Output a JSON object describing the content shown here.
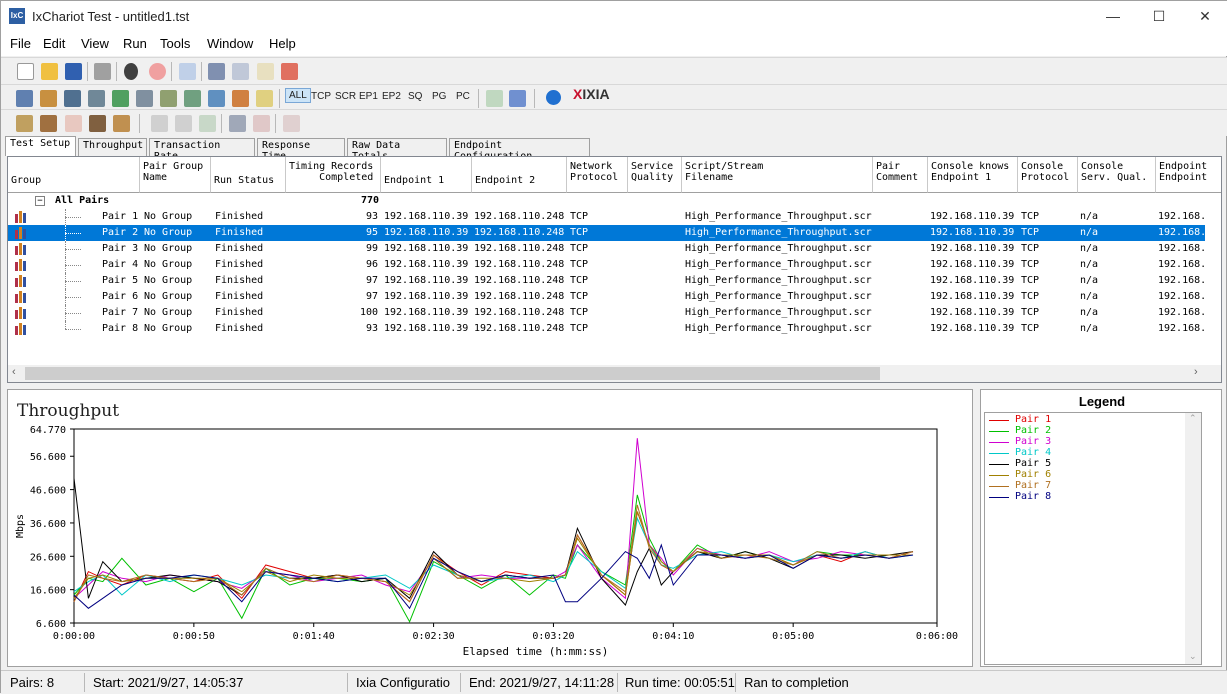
{
  "window": {
    "title": "IxChariot Test - untitled1.tst",
    "icon_text": "IxC"
  },
  "menu": [
    "File",
    "Edit",
    "View",
    "Run",
    "Tools",
    "Window",
    "Help"
  ],
  "menu_underline": [
    "F",
    "E",
    "V",
    "R",
    "T",
    "W",
    "H"
  ],
  "toolbar2_filters": [
    "ALL",
    "TCP",
    "SCR",
    "EP1",
    "EP2",
    "SQ",
    "PG",
    "PC"
  ],
  "logo": {
    "x": "X",
    "rest": "IXIA"
  },
  "tabs": [
    "Test Setup",
    "Throughput",
    "Transaction Rate",
    "Response Time",
    "Raw Data Totals",
    "Endpoint Configuration"
  ],
  "columns": {
    "group": "Group",
    "pair_group": "Pair Group\nName",
    "run_status": "Run Status",
    "timing": "Timing Records\n     Completed",
    "ep1": "Endpoint 1",
    "ep2": "Endpoint 2",
    "proto": "Network\nProtocol",
    "sq": "Service\nQuality",
    "script": "Script/Stream\nFilename",
    "comment": "Pair\nComment",
    "console_knows": "Console knows\nEndpoint 1",
    "console_proto": "Console\nProtocol",
    "console_sq": "Console\nServ. Qual.",
    "endpoint_last": "Endpoint\nEndpoint"
  },
  "all_pairs": {
    "label": "All Pairs",
    "total": "770",
    "expander": "−"
  },
  "rows": [
    {
      "pair": "Pair 1",
      "group": "No Group",
      "status": "Finished",
      "records": "93",
      "ep1": "192.168.110.39",
      "ep2": "192.168.110.248",
      "proto": "TCP",
      "script": "High_Performance_Throughput.scr",
      "console": "192.168.110.39",
      "cproto": "TCP",
      "csq": "n/a",
      "last": "192.168."
    },
    {
      "pair": "Pair 2",
      "group": "No Group",
      "status": "Finished",
      "records": "95",
      "ep1": "192.168.110.39",
      "ep2": "192.168.110.248",
      "proto": "TCP",
      "script": "High_Performance_Throughput.scr",
      "console": "192.168.110.39",
      "cproto": "TCP",
      "csq": "n/a",
      "last": "192.168."
    },
    {
      "pair": "Pair 3",
      "group": "No Group",
      "status": "Finished",
      "records": "99",
      "ep1": "192.168.110.39",
      "ep2": "192.168.110.248",
      "proto": "TCP",
      "script": "High_Performance_Throughput.scr",
      "console": "192.168.110.39",
      "cproto": "TCP",
      "csq": "n/a",
      "last": "192.168."
    },
    {
      "pair": "Pair 4",
      "group": "No Group",
      "status": "Finished",
      "records": "96",
      "ep1": "192.168.110.39",
      "ep2": "192.168.110.248",
      "proto": "TCP",
      "script": "High_Performance_Throughput.scr",
      "console": "192.168.110.39",
      "cproto": "TCP",
      "csq": "n/a",
      "last": "192.168."
    },
    {
      "pair": "Pair 5",
      "group": "No Group",
      "status": "Finished",
      "records": "97",
      "ep1": "192.168.110.39",
      "ep2": "192.168.110.248",
      "proto": "TCP",
      "script": "High_Performance_Throughput.scr",
      "console": "192.168.110.39",
      "cproto": "TCP",
      "csq": "n/a",
      "last": "192.168."
    },
    {
      "pair": "Pair 6",
      "group": "No Group",
      "status": "Finished",
      "records": "97",
      "ep1": "192.168.110.39",
      "ep2": "192.168.110.248",
      "proto": "TCP",
      "script": "High_Performance_Throughput.scr",
      "console": "192.168.110.39",
      "cproto": "TCP",
      "csq": "n/a",
      "last": "192.168."
    },
    {
      "pair": "Pair 7",
      "group": "No Group",
      "status": "Finished",
      "records": "100",
      "ep1": "192.168.110.39",
      "ep2": "192.168.110.248",
      "proto": "TCP",
      "script": "High_Performance_Throughput.scr",
      "console": "192.168.110.39",
      "cproto": "TCP",
      "csq": "n/a",
      "last": "192.168."
    },
    {
      "pair": "Pair 8",
      "group": "No Group",
      "status": "Finished",
      "records": "93",
      "ep1": "192.168.110.39",
      "ep2": "192.168.110.248",
      "proto": "TCP",
      "script": "High_Performance_Throughput.scr",
      "console": "192.168.110.39",
      "cproto": "TCP",
      "csq": "n/a",
      "last": "192.168."
    }
  ],
  "selected_row": 1,
  "legend": {
    "title": "Legend",
    "items": [
      {
        "name": "Pair 1",
        "color": "#e00000"
      },
      {
        "name": "Pair 2",
        "color": "#00c000"
      },
      {
        "name": "Pair 3",
        "color": "#d000d0"
      },
      {
        "name": "Pair 4",
        "color": "#00c8c8"
      },
      {
        "name": "Pair 5",
        "color": "#000000"
      },
      {
        "name": "Pair 6",
        "color": "#a08000"
      },
      {
        "name": "Pair 7",
        "color": "#b07020"
      },
      {
        "name": "Pair 8",
        "color": "#000080"
      }
    ]
  },
  "chart_data": {
    "type": "line",
    "title": "Throughput",
    "xlabel": "Elapsed time (h:mm:ss)",
    "ylabel": "Mbps",
    "x_ticks": [
      "0:00:00",
      "0:00:50",
      "0:01:40",
      "0:02:30",
      "0:03:20",
      "0:04:10",
      "0:05:00",
      "0:06:00"
    ],
    "x_tick_seconds": [
      0,
      50,
      100,
      150,
      200,
      250,
      300,
      360
    ],
    "y_ticks": [
      "64.770",
      "56.600",
      "46.600",
      "36.600",
      "26.600",
      "16.600",
      "6.600"
    ],
    "y_tick_values": [
      64.77,
      56.6,
      46.6,
      36.6,
      26.6,
      16.6,
      6.6
    ],
    "xlim": [
      0,
      360
    ],
    "ylim": [
      6.6,
      64.77
    ],
    "grid": false,
    "series": [
      {
        "name": "Pair 1",
        "x": [
          0,
          6,
          12,
          20,
          30,
          40,
          50,
          60,
          70,
          80,
          90,
          100,
          110,
          120,
          130,
          140,
          150,
          160,
          170,
          180,
          190,
          200,
          205,
          210,
          220,
          230,
          235,
          240,
          245,
          250,
          260,
          270,
          280,
          290,
          300,
          310,
          320,
          330,
          340,
          350
        ],
        "y": [
          13,
          22,
          20,
          18,
          21,
          20,
          19,
          21,
          14,
          24,
          22,
          20,
          21,
          20,
          19,
          13,
          27,
          22,
          18,
          22,
          21,
          20,
          21,
          33,
          21,
          15,
          40,
          30,
          24,
          22,
          28,
          27,
          26,
          27,
          24,
          27,
          25,
          28,
          26,
          28
        ]
      },
      {
        "name": "Pair 2",
        "x": [
          0,
          6,
          12,
          20,
          30,
          40,
          50,
          60,
          70,
          80,
          90,
          100,
          110,
          120,
          130,
          140,
          150,
          160,
          170,
          180,
          190,
          200,
          205,
          210,
          220,
          230,
          235,
          240,
          245,
          250,
          260,
          270,
          280,
          290,
          300,
          310,
          320,
          330,
          340,
          350
        ],
        "y": [
          15,
          20,
          19,
          26,
          18,
          20,
          16,
          20,
          8,
          23,
          18,
          20,
          20,
          19,
          20,
          7,
          25,
          21,
          17,
          21,
          15,
          21,
          20,
          30,
          22,
          18,
          45,
          32,
          25,
          22,
          30,
          26,
          28,
          26,
          24,
          28,
          27,
          27,
          27,
          27
        ]
      },
      {
        "name": "Pair 3",
        "x": [
          0,
          6,
          12,
          20,
          30,
          40,
          50,
          60,
          70,
          80,
          90,
          100,
          110,
          120,
          130,
          140,
          150,
          160,
          170,
          180,
          190,
          200,
          205,
          210,
          220,
          230,
          235,
          240,
          245,
          250,
          260,
          270,
          280,
          290,
          300,
          310,
          320,
          330,
          340,
          350
        ],
        "y": [
          14,
          18,
          22,
          20,
          19,
          21,
          20,
          19,
          17,
          22,
          21,
          19,
          20,
          21,
          18,
          16,
          26,
          20,
          21,
          20,
          20,
          20,
          22,
          30,
          20,
          14,
          62,
          30,
          26,
          21,
          29,
          27,
          26,
          28,
          25,
          26,
          28,
          27,
          27,
          27
        ]
      },
      {
        "name": "Pair 4",
        "x": [
          0,
          6,
          12,
          20,
          30,
          40,
          50,
          60,
          70,
          80,
          90,
          100,
          110,
          120,
          130,
          140,
          150,
          160,
          170,
          180,
          190,
          200,
          205,
          210,
          220,
          230,
          235,
          240,
          245,
          250,
          260,
          270,
          280,
          290,
          300,
          310,
          320,
          330,
          340,
          350
        ],
        "y": [
          16,
          19,
          21,
          15,
          21,
          19,
          21,
          20,
          18,
          21,
          20,
          20,
          19,
          20,
          21,
          17,
          24,
          21,
          19,
          20,
          21,
          19,
          21,
          28,
          22,
          17,
          38,
          30,
          24,
          23,
          27,
          28,
          26,
          27,
          25,
          27,
          26,
          28,
          26,
          27
        ]
      },
      {
        "name": "Pair 5",
        "x": [
          0,
          6,
          12,
          20,
          30,
          40,
          50,
          60,
          70,
          80,
          90,
          100,
          110,
          120,
          130,
          140,
          150,
          160,
          170,
          180,
          190,
          200,
          205,
          210,
          220,
          230,
          235,
          240,
          245,
          250,
          260,
          270,
          280,
          290,
          300,
          310,
          320,
          330,
          340,
          350
        ],
        "y": [
          50,
          14,
          25,
          19,
          20,
          21,
          20,
          19,
          15,
          23,
          20,
          20,
          21,
          19,
          20,
          14,
          28,
          21,
          19,
          21,
          20,
          20,
          21,
          35,
          20,
          12,
          22,
          29,
          18,
          22,
          28,
          26,
          28,
          26,
          23,
          27,
          27,
          26,
          27,
          28
        ]
      },
      {
        "name": "Pair 6",
        "x": [
          0,
          6,
          12,
          20,
          30,
          40,
          50,
          60,
          70,
          80,
          90,
          100,
          110,
          120,
          130,
          140,
          150,
          160,
          170,
          180,
          190,
          200,
          205,
          210,
          220,
          230,
          235,
          240,
          245,
          250,
          260,
          270,
          280,
          290,
          300,
          310,
          320,
          330,
          340,
          350
        ],
        "y": [
          14,
          20,
          21,
          19,
          20,
          20,
          20,
          20,
          16,
          22,
          19,
          21,
          20,
          20,
          19,
          15,
          26,
          20,
          20,
          20,
          19,
          20,
          21,
          32,
          21,
          15,
          40,
          30,
          25,
          22,
          28,
          27,
          27,
          27,
          24,
          27,
          26,
          27,
          27,
          27
        ]
      },
      {
        "name": "Pair 7",
        "x": [
          0,
          6,
          12,
          20,
          30,
          40,
          50,
          60,
          70,
          80,
          90,
          100,
          110,
          120,
          130,
          140,
          150,
          160,
          170,
          180,
          190,
          200,
          205,
          210,
          220,
          230,
          235,
          240,
          245,
          250,
          260,
          270,
          280,
          290,
          300,
          310,
          320,
          330,
          340,
          350
        ],
        "y": [
          13,
          21,
          20,
          19,
          21,
          20,
          19,
          20,
          15,
          23,
          20,
          19,
          21,
          20,
          19,
          13,
          27,
          21,
          19,
          21,
          20,
          20,
          21,
          33,
          21,
          16,
          42,
          29,
          24,
          22,
          29,
          26,
          27,
          26,
          24,
          28,
          26,
          27,
          26,
          28
        ]
      },
      {
        "name": "Pair 8",
        "x": [
          0,
          6,
          12,
          20,
          30,
          40,
          50,
          60,
          70,
          80,
          90,
          100,
          110,
          120,
          130,
          140,
          150,
          160,
          170,
          180,
          190,
          200,
          205,
          210,
          220,
          230,
          235,
          240,
          245,
          250,
          260,
          270,
          280,
          290,
          300,
          310,
          320,
          330,
          340,
          350
        ],
        "y": [
          15,
          11,
          14,
          18,
          20,
          20,
          21,
          20,
          13,
          22,
          21,
          20,
          19,
          20,
          20,
          11,
          26,
          22,
          19,
          21,
          20,
          21,
          13,
          13,
          20,
          28,
          26,
          20,
          30,
          18,
          27,
          27,
          26,
          27,
          23,
          27,
          26,
          27,
          26,
          27
        ]
      }
    ]
  },
  "status": {
    "pairs": "Pairs: 8",
    "start": "Start: 2021/9/27, 14:05:37",
    "config": "Ixia Configuratio",
    "end": "End: 2021/9/27, 14:11:28",
    "runtime": "Run time: 00:05:51",
    "result": "Ran to completion"
  }
}
